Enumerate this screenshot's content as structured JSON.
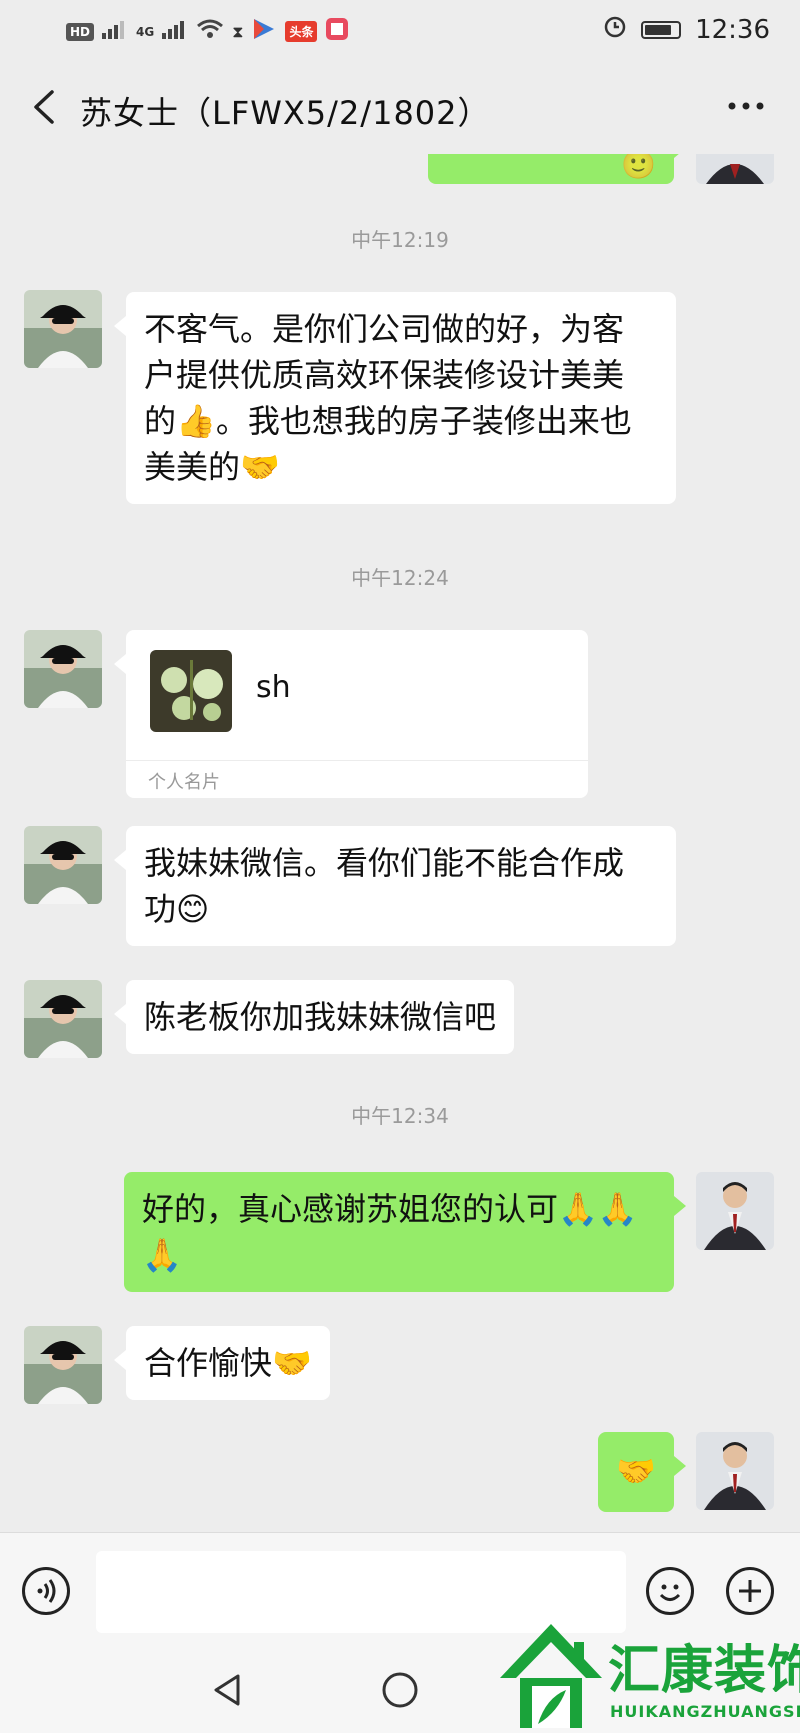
{
  "status_bar": {
    "time": "12:36",
    "network": "4G",
    "left_chips": [
      "HD",
      "头条"
    ]
  },
  "header": {
    "title": "苏女士（LFWX5/2/1802）",
    "back_icon": "chevron-left-icon",
    "more_icon": "more-dots-icon"
  },
  "chat": {
    "timestamps": [
      "中午12:19",
      "中午12:24",
      "中午12:34"
    ],
    "messages": [
      {
        "from": "contact",
        "lines": [
          "不客气。是你们公司做的好，为客",
          "户提供优质高效环保装修设计美美",
          "的👍。我也想我的房子装修出来也",
          "美美的🤝"
        ]
      },
      {
        "from": "contact",
        "type": "card",
        "name": "sh",
        "label": "个人名片"
      },
      {
        "from": "contact",
        "lines": [
          "我妹妹微信。看你们能不能合作成",
          "功😊"
        ]
      },
      {
        "from": "contact",
        "lines": [
          "陈老板你加我妹妹微信吧"
        ]
      },
      {
        "from": "me",
        "lines": [
          "好的，真心感谢苏姐您的认可🙏🙏",
          "🙏"
        ]
      },
      {
        "from": "contact",
        "lines": [
          "合作愉快🤝"
        ]
      },
      {
        "from": "me",
        "lines": [
          "🤝"
        ]
      }
    ]
  },
  "input_bar": {
    "voice_icon": "voice-icon",
    "emoji_icon": "emoji-icon",
    "plus_icon": "plus-icon"
  },
  "watermark": {
    "brand_cn": "汇康装饰",
    "brand_en": "HUIKANGZHUANGSHI"
  },
  "colors": {
    "background": "#ededed",
    "bubble_out": "#95ec69",
    "bubble_in": "#ffffff",
    "brand_green": "#1aa33a"
  }
}
